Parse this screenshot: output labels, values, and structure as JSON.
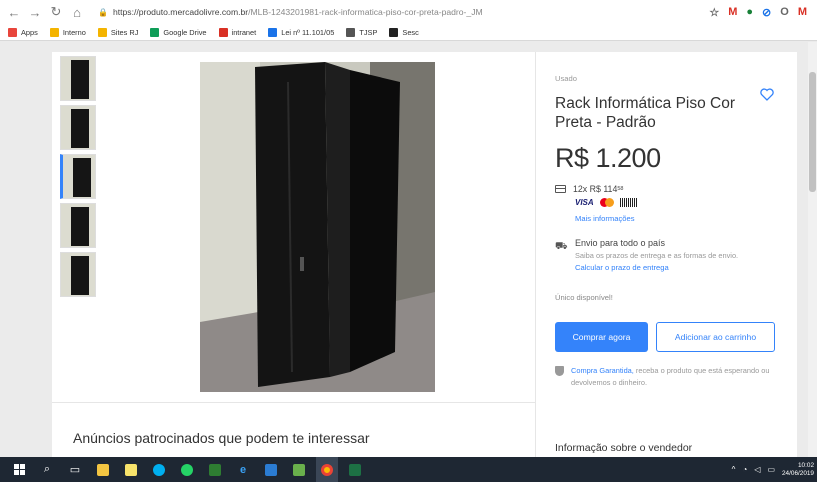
{
  "browser": {
    "url_domain": "https://produto.mercadolivre.com.br",
    "url_path": "/MLB-1243201981-rack-informatica-piso-cor-preta-padro-_JM",
    "extensions": [
      {
        "glyph": "☆",
        "color": "#666666"
      },
      {
        "glyph": "M",
        "color": "#d93025"
      },
      {
        "glyph": "●",
        "color": "#188038"
      },
      {
        "glyph": "⊘",
        "color": "#1a73e8"
      },
      {
        "glyph": "O",
        "color": "#666666"
      },
      {
        "glyph": "M",
        "color": "#d93025"
      }
    ]
  },
  "bookmarks": [
    {
      "label": "Apps",
      "icon_color": "#e8453c"
    },
    {
      "label": "Interno",
      "icon_color": "#f4b400"
    },
    {
      "label": "Sites RJ",
      "icon_color": "#f4b400"
    },
    {
      "label": "Google Drive",
      "icon_color": "#0f9d58"
    },
    {
      "label": "intranet",
      "icon_color": "#d93025"
    },
    {
      "label": "Lei nº 11.101/05",
      "icon_color": "#1a73e8"
    },
    {
      "label": "TJSP",
      "icon_color": "#555555"
    },
    {
      "label": "Sesc",
      "icon_color": "#222222"
    }
  ],
  "product": {
    "condition": "Usado",
    "title": "Rack Informática Piso Cor Preta - Padrão",
    "price": "R$ 1.200",
    "installments": "12x R$ 114",
    "installments_cents": "58",
    "payment_visa": "VISA",
    "more_info": "Mais informações",
    "shipping_title": "Envio para todo o país",
    "shipping_subtitle": "Saiba os prazos de entrega e as formas de envio.",
    "shipping_link": "Calcular o prazo de entrega",
    "stock": "Único disponível!",
    "buy_now": "Comprar agora",
    "add_to_cart": "Adicionar ao carrinho",
    "guarantee_link": "Compra Garantida,",
    "guarantee_text": " receba o produto que está esperando ou devolvemos o dinheiro.",
    "seller_info": "Informação sobre o vendedor",
    "accent_color": "#3483fa"
  },
  "sponsored": "Anúncios patrocinados que podem te interessar",
  "taskbar": {
    "clock_time": "10:02",
    "clock_date": "24/06/2019"
  }
}
